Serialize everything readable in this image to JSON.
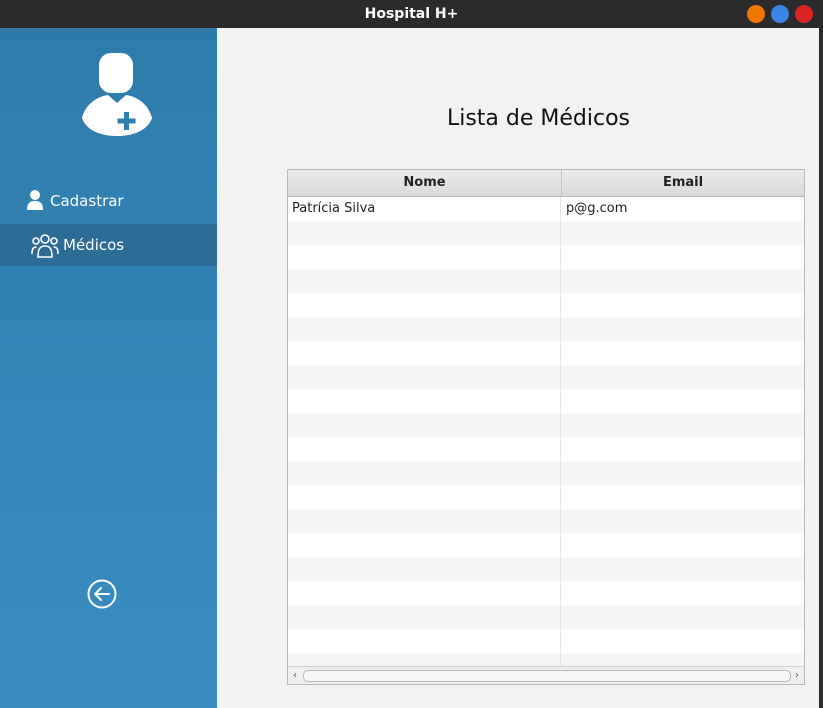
{
  "window": {
    "title": "Hospital H+",
    "buttons": [
      {
        "name": "minimize",
        "color": "#f07800"
      },
      {
        "name": "maximize",
        "color": "#3b84e6"
      },
      {
        "name": "close",
        "color": "#d92424"
      }
    ]
  },
  "sidebar": {
    "logo_icon": "doctor-plus-icon",
    "items": [
      {
        "label": "Cadastrar",
        "icon": "user-icon",
        "selected": false
      },
      {
        "label": "Médicos",
        "icon": "users-group-icon",
        "selected": true
      }
    ],
    "back_icon": "back-arrow-circle-icon",
    "colors": {
      "background": "#3585b9",
      "selected": "#2c6c97"
    }
  },
  "main": {
    "title": "Lista de Médicos",
    "table": {
      "columns": [
        "Nome",
        "Email"
      ],
      "rows": [
        {
          "nome": "Patrícia Silva",
          "email": "p@g.com"
        }
      ]
    },
    "scrollbar": {
      "left_arrow": "‹",
      "right_arrow": "›"
    }
  }
}
